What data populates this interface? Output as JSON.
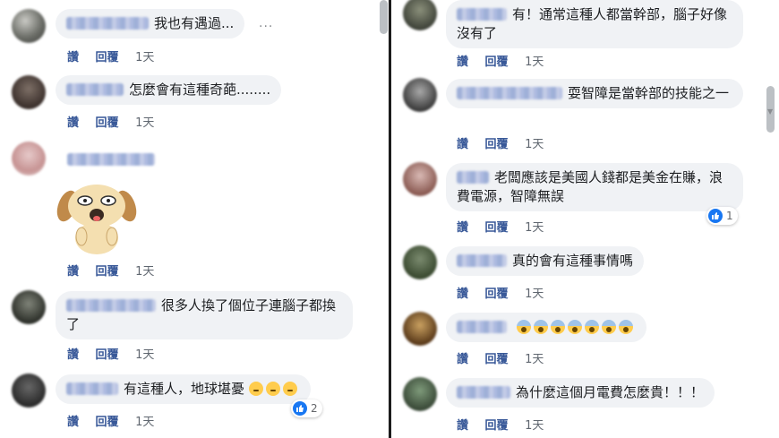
{
  "actions": {
    "like": "讚",
    "reply": "回覆",
    "time": "1天"
  },
  "more": "···",
  "left_comments": [
    {
      "text": "我也有遇過..."
    },
    {
      "text": "怎麼會有這種奇葩........"
    },
    {
      "text": ""
    },
    {
      "text": "很多人換了個位子連腦子都換了"
    },
    {
      "text": "有這種人，地球堪憂",
      "reactions": "2"
    }
  ],
  "right_comments": [
    {
      "text": "有！通常這種人都當幹部，腦子好像沒有了"
    },
    {
      "text": "耍智障是當幹部的技能之一"
    },
    {
      "text": "老闆應該是美國人錢都是美金在賺，浪費電源，智障無誤",
      "reactions": "1"
    },
    {
      "text": "真的會有這種事情嗎"
    },
    {
      "text": ""
    },
    {
      "text": "為什麼這個月電費怎麼貴！！！"
    }
  ],
  "colors": {
    "bubble": "#f0f2f5",
    "link": "#385898",
    "like": "#1877f2"
  },
  "icons": {
    "like": "thumbs-up-icon",
    "emoji_think": "thinking-face-icon",
    "emoji_scream": "face-screaming-in-fear-icon"
  }
}
